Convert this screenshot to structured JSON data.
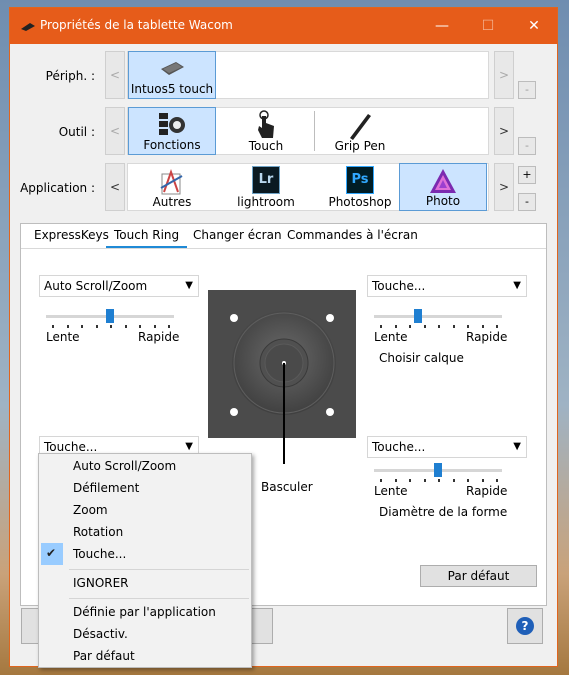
{
  "window": {
    "title": "Propriétés de la tablette Wacom",
    "minimize": "—",
    "maximize": "☐",
    "close": "✕",
    "titlebar_color": "#e65c1a"
  },
  "rows": {
    "device_label": "Périph. :",
    "tool_label": "Outil :",
    "app_label": "Application :",
    "devices": [
      {
        "label": "Intuos5 touch",
        "selected": true
      }
    ],
    "tools": [
      {
        "label": "Fonctions",
        "selected": true
      },
      {
        "label": "Touch",
        "selected": false
      },
      {
        "label": "Grip Pen",
        "selected": false
      }
    ],
    "apps": [
      {
        "label": "Autres",
        "selected": false
      },
      {
        "label": "lightroom",
        "icon_text": "Lr",
        "selected": false
      },
      {
        "label": "Photoshop",
        "icon_text": "Ps",
        "selected": false
      },
      {
        "label": "Photo",
        "selected": true
      }
    ],
    "left_arrow": "<",
    "right_arrow": ">",
    "plus": "+",
    "minus": "-"
  },
  "tabs": [
    "ExpressKeys",
    "Touch Ring",
    "Changer écran",
    "Commandes à l'écran"
  ],
  "active_tab": "Touch Ring",
  "touch_ring": {
    "top_left": {
      "mode": "Auto Scroll/Zoom",
      "slow": "Lente",
      "fast": "Rapide",
      "speed_fraction": 0.5
    },
    "top_right": {
      "mode": "Touche...",
      "slow": "Lente",
      "fast": "Rapide",
      "speed_fraction": 0.33,
      "caption": "Choisir calque"
    },
    "bottom_left": {
      "mode": "Touche..."
    },
    "bottom_right": {
      "mode": "Touche...",
      "slow": "Lente",
      "fast": "Rapide",
      "speed_fraction": 0.5,
      "caption": "Diamètre de la forme"
    },
    "center_label": "Basculer",
    "default_button": "Par défaut",
    "help_icon": "?"
  },
  "dropdown_menu": {
    "items": [
      {
        "label": "Auto Scroll/Zoom",
        "checked": false
      },
      {
        "label": "Défilement",
        "checked": false
      },
      {
        "label": "Zoom",
        "checked": false
      },
      {
        "label": "Rotation",
        "checked": false
      },
      {
        "label": "Touche...",
        "checked": true
      },
      {
        "label": "IGNORER",
        "checked": false
      },
      {
        "label": "Définie par l'application",
        "checked": false
      },
      {
        "label": "Désactiv.",
        "checked": false
      },
      {
        "label": "Par défaut",
        "checked": false
      }
    ],
    "check_icon": "✔"
  }
}
